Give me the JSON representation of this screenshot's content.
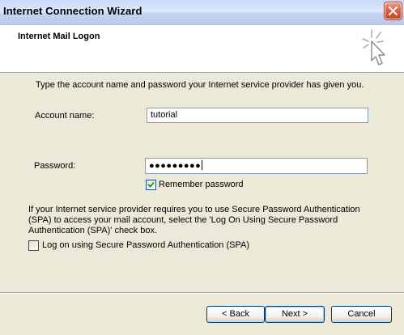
{
  "window": {
    "title": "Internet Connection Wizard"
  },
  "header": {
    "title": "Internet Mail Logon",
    "icon": "wizard-sparkle-icon"
  },
  "body": {
    "intro": "Type the account name and password your Internet service provider has given you.",
    "account_label": "Account name:",
    "account_value": "tutorial",
    "password_label": "Password:",
    "password_value": "●●●●●●●●●",
    "remember_label": "Remember password",
    "remember_checked": true,
    "spa_note": "If your Internet service provider requires you to use Secure Password Authentication (SPA) to access your mail account, select the 'Log On Using Secure Password Authentication (SPA)' check box.",
    "spa_label": "Log on using Secure Password Authentication (SPA)",
    "spa_checked": false
  },
  "buttons": {
    "back": "< Back",
    "next": "Next >",
    "cancel": "Cancel"
  },
  "colors": {
    "dialog_bg": "#ece9d8",
    "field_border": "#7f9db9",
    "checkmark": "#21a121",
    "close_red": "#c4472a"
  }
}
